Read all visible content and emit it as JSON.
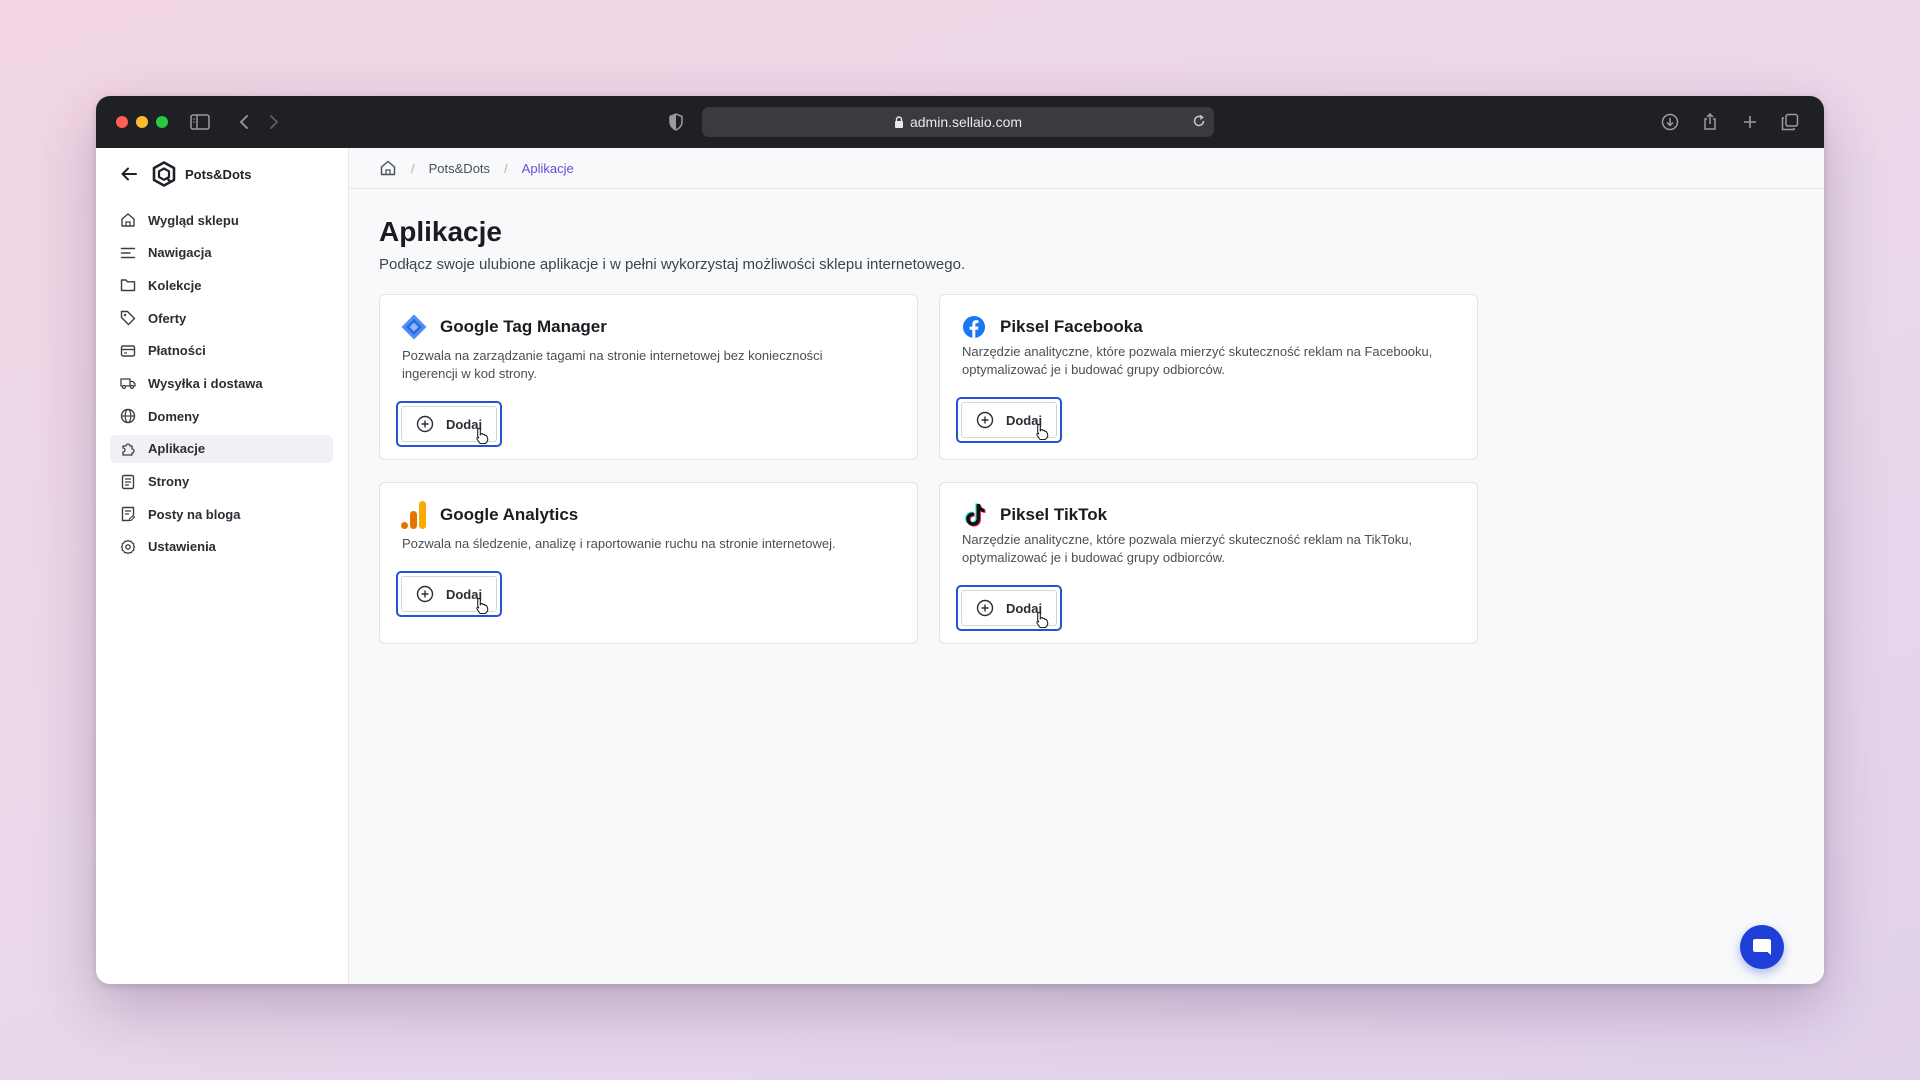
{
  "browser": {
    "url": "admin.sellaio.com"
  },
  "sidebar": {
    "store_name": "Pots&Dots",
    "items": [
      {
        "label": "Wygląd sklepu",
        "icon": "house-icon"
      },
      {
        "label": "Nawigacja",
        "icon": "menu-lines-icon"
      },
      {
        "label": "Kolekcje",
        "icon": "folder-icon"
      },
      {
        "label": "Oferty",
        "icon": "tag-icon"
      },
      {
        "label": "Płatności",
        "icon": "credit-card-icon"
      },
      {
        "label": "Wysyłka i dostawa",
        "icon": "truck-icon"
      },
      {
        "label": "Domeny",
        "icon": "globe-icon"
      },
      {
        "label": "Aplikacje",
        "icon": "puzzle-icon",
        "active": true
      },
      {
        "label": "Strony",
        "icon": "page-icon"
      },
      {
        "label": "Posty na bloga",
        "icon": "blog-post-icon"
      },
      {
        "label": "Ustawienia",
        "icon": "gear-icon"
      }
    ]
  },
  "breadcrumb": {
    "store": "Pots&Dots",
    "current": "Aplikacje"
  },
  "page": {
    "title": "Aplikacje",
    "subtitle": "Podłącz swoje ulubione aplikacje i w pełni wykorzystaj możliwości sklepu internetowego."
  },
  "apps": [
    {
      "name": "Google Tag Manager",
      "description": "Pozwala na zarządzanie tagami na stronie internetowej bez konieczności ingerencji w kod strony.",
      "button": "Dodaj",
      "icon": "google-tag-manager-icon"
    },
    {
      "name": "Piksel Facebooka",
      "description": "Narzędzie analityczne, które pozwala mierzyć skuteczność reklam na Facebooku, optymalizować je i budować grupy odbiorców.",
      "button": "Dodaj",
      "icon": "facebook-icon"
    },
    {
      "name": "Google Analytics",
      "description": "Pozwala na śledzenie, analizę i raportowanie ruchu na stronie internetowej.",
      "button": "Dodaj",
      "icon": "google-analytics-icon"
    },
    {
      "name": "Piksel TikTok",
      "description": "Narzędzie analityczne, które pozwala mierzyć skuteczność reklam na TikToku, optymalizować je i budować grupy odbiorców.",
      "button": "Dodaj",
      "icon": "tiktok-icon"
    }
  ],
  "colors": {
    "accent": "#2454d6",
    "breadcrumb_current": "#6b4bd6",
    "chat_button": "#1e3fd8"
  }
}
